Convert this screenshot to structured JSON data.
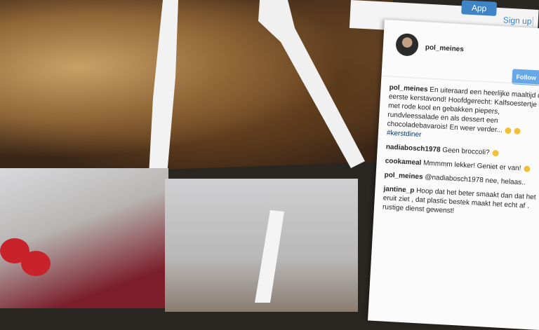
{
  "topbar": {
    "app_label": "App",
    "signup_label": "Sign up"
  },
  "post": {
    "username": "pol_meines",
    "follow_label": "Follow",
    "caption": "En uiteraard een heerlijke maaltijd op eerste kerstavond! Hoofdgerecht: Kalfsoestertje met rode kool en gebakken piepers, rundvleessalade en als dessert een chocoladebavarois! En weer verder...",
    "hashtag": "#kerstdiner"
  },
  "comments": [
    {
      "user": "nadiabosch1978",
      "text": "Geen broccoli?"
    },
    {
      "user": "cookameal",
      "text": "Mmmmm lekker! Geniet er van!"
    },
    {
      "user": "pol_meines",
      "text": "@nadiabosch1978 nee, helaas.."
    },
    {
      "user": "jantine_p",
      "text": "Hoop dat het beter smaakt dan dat het eruit ziet , dat plastic bestek maakt het echt af . rustige dienst gewenst!"
    }
  ]
}
